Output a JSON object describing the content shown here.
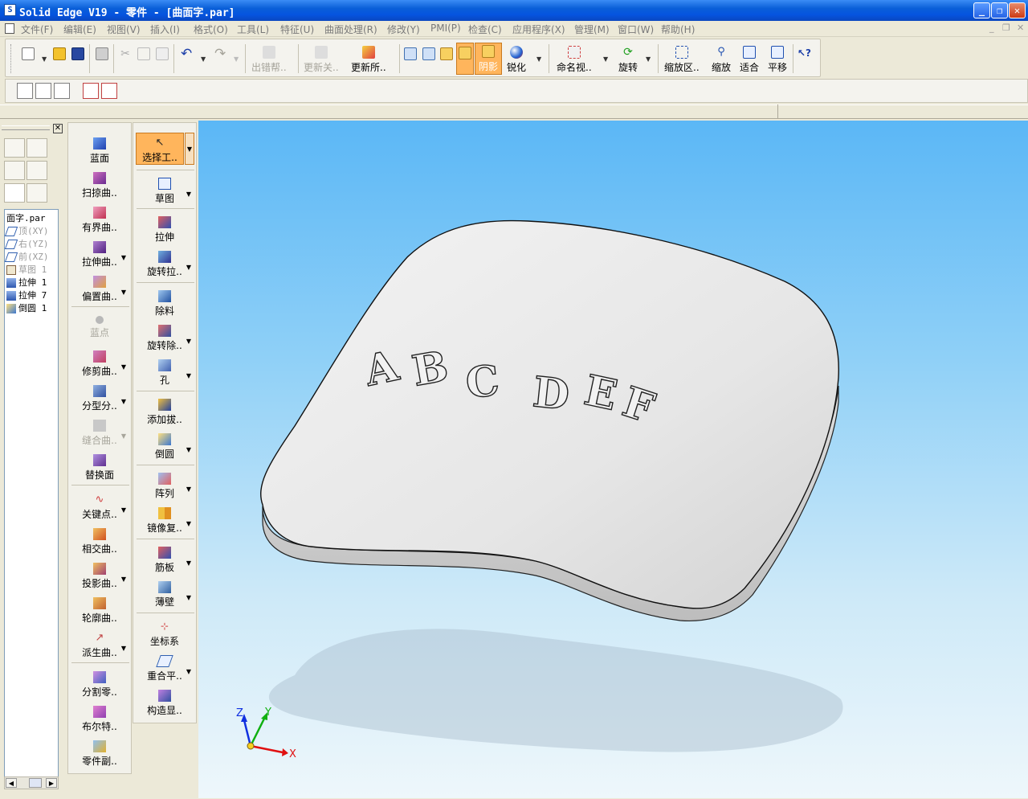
{
  "title_bar": {
    "app_icon": "solid-edge-logo",
    "title": "Solid Edge V19 - 零件 - [曲面字.par]"
  },
  "menu": {
    "items": [
      "文件(F)",
      "编辑(E)",
      "视图(V)",
      "插入(I)",
      "格式(O)",
      "工具(L)",
      "特征(U)",
      "曲面处理(R)",
      "修改(Y)",
      "PMI(P)",
      "检查(C)",
      "应用程序(X)",
      "管理(M)",
      "窗口(W)",
      "帮助(H)"
    ]
  },
  "toolbar": {
    "buttons": [
      {
        "label": "出错帮..",
        "enabled": false
      },
      {
        "label": "更新关..",
        "enabled": false
      },
      {
        "label": "更新所..",
        "enabled": true
      },
      {
        "label": "阴影",
        "enabled": true,
        "active": true
      },
      {
        "label": "锐化",
        "enabled": true
      },
      {
        "label": "命名视..",
        "enabled": true
      },
      {
        "label": "旋转",
        "enabled": true
      },
      {
        "label": "缩放区..",
        "enabled": true
      },
      {
        "label": "缩放",
        "enabled": true
      },
      {
        "label": "适合",
        "enabled": true
      },
      {
        "label": "平移",
        "enabled": true
      }
    ]
  },
  "pathfinder": {
    "tree": [
      {
        "label": "面字.par",
        "dim": false
      },
      {
        "label": "顶(XY)",
        "dim": true
      },
      {
        "label": "右(YZ)",
        "dim": true
      },
      {
        "label": "前(XZ)",
        "dim": true
      },
      {
        "label": "草图 1",
        "dim": true
      },
      {
        "label": "拉伸 1",
        "dim": false
      },
      {
        "label": "拉伸 7",
        "dim": false
      },
      {
        "label": "倒圆 1",
        "dim": false
      }
    ]
  },
  "surfacing_panel": {
    "items": [
      {
        "label": "蓝面",
        "enabled": true
      },
      {
        "label": "扫掠曲..",
        "enabled": true
      },
      {
        "label": "有界曲..",
        "enabled": true
      },
      {
        "label": "拉伸曲..",
        "enabled": true
      },
      {
        "label": "偏置曲..",
        "enabled": true
      },
      {
        "label": "蓝点",
        "enabled": false
      },
      {
        "label": "修剪曲..",
        "enabled": true
      },
      {
        "label": "分型分..",
        "enabled": true
      },
      {
        "label": "缝合曲..",
        "enabled": false
      },
      {
        "label": "替换面",
        "enabled": true
      },
      {
        "label": "关键点..",
        "enabled": true
      },
      {
        "label": "相交曲..",
        "enabled": true
      },
      {
        "label": "投影曲..",
        "enabled": true
      },
      {
        "label": "轮廓曲..",
        "enabled": true
      },
      {
        "label": "派生曲..",
        "enabled": true
      },
      {
        "label": "分割零..",
        "enabled": true
      },
      {
        "label": "布尔特..",
        "enabled": true
      },
      {
        "label": "零件副..",
        "enabled": true
      }
    ]
  },
  "features_panel": {
    "items": [
      {
        "label": "选择工..",
        "active": true
      },
      {
        "label": "草图"
      },
      {
        "label": "拉伸"
      },
      {
        "label": "旋转拉.."
      },
      {
        "label": "除料"
      },
      {
        "label": "旋转除.."
      },
      {
        "label": "孔"
      },
      {
        "label": "添加拔.."
      },
      {
        "label": "倒圆"
      },
      {
        "label": "阵列"
      },
      {
        "label": "镜像复.."
      },
      {
        "label": "筋板"
      },
      {
        "label": "薄壁"
      },
      {
        "label": "坐标系"
      },
      {
        "label": "重合平.."
      },
      {
        "label": "构造显.."
      }
    ]
  },
  "viewport": {
    "model_text": [
      "A",
      "B",
      "C",
      "D",
      "E",
      "F"
    ],
    "triad": {
      "x": "X",
      "y": "Y",
      "z": "Z"
    },
    "colors": {
      "x": "#e01010",
      "y": "#10b010",
      "z": "#1030e0",
      "sky_top": "#5bb7f6",
      "sky_bottom": "#eef7fb"
    }
  }
}
